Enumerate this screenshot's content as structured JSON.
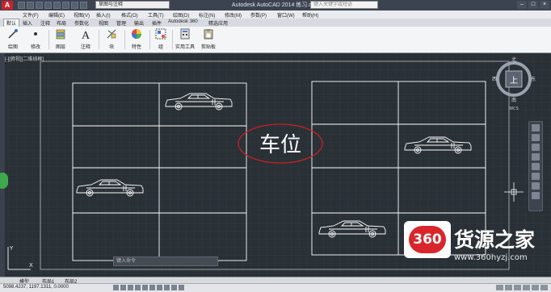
{
  "titlebar": {
    "app_logo": "A",
    "workspace_select": "草图与注释",
    "title": "Autodesk AutoCAD 2014   练习.dwg",
    "search_placeholder": "键入关键字或短语"
  },
  "menubar": {
    "items": [
      "文件(F)",
      "编辑(E)",
      "视图(V)",
      "插入(I)",
      "格式(O)",
      "工具(T)",
      "绘图(D)",
      "标注(N)",
      "修改(M)",
      "参数(P)",
      "窗口(W)",
      "帮助(H)"
    ]
  },
  "ribbon_tabs": [
    "默认",
    "插入",
    "注释",
    "布局",
    "参数化",
    "视图",
    "管理",
    "输出",
    "插件",
    "Autodesk 360",
    "精选应用"
  ],
  "ribbon_buttons": [
    {
      "label": "绘图",
      "icon": "draw-icon"
    },
    {
      "label": "修改",
      "icon": "modify-icon"
    },
    {
      "label": "图层",
      "icon": "layers-icon"
    },
    {
      "label": "注释",
      "icon": "annotation-icon"
    },
    {
      "label": "块",
      "icon": "block-icon"
    },
    {
      "label": "特性",
      "icon": "properties-icon"
    },
    {
      "label": "组",
      "icon": "group-icon"
    },
    {
      "label": "实用工具",
      "icon": "utilities-icon"
    },
    {
      "label": "剪贴板",
      "icon": "clipboard-icon"
    }
  ],
  "viewport": {
    "label": "[-][俯视][二维线框]",
    "annotation_text": "车位",
    "viewcube_label": "上",
    "compass_n": "北",
    "compass_s": "南",
    "compass_w": "西",
    "compass_e": "东",
    "compass_wcs": "WCS"
  },
  "command": {
    "placeholder": "键入命令"
  },
  "layout_tabs": [
    "模型",
    "布局1",
    "布局2"
  ],
  "status": {
    "coordinates": "5098.4237, 1197.1311, 0.0000"
  },
  "watermark": {
    "logo_text": "360",
    "brand_name": "货源之家",
    "url": "www.360hyzj.com"
  },
  "colors": {
    "viewport_bg": "#293036",
    "linework": "#ffffff",
    "annotation_ellipse": "#cc1f1f",
    "brand_red": "#d8262c"
  }
}
